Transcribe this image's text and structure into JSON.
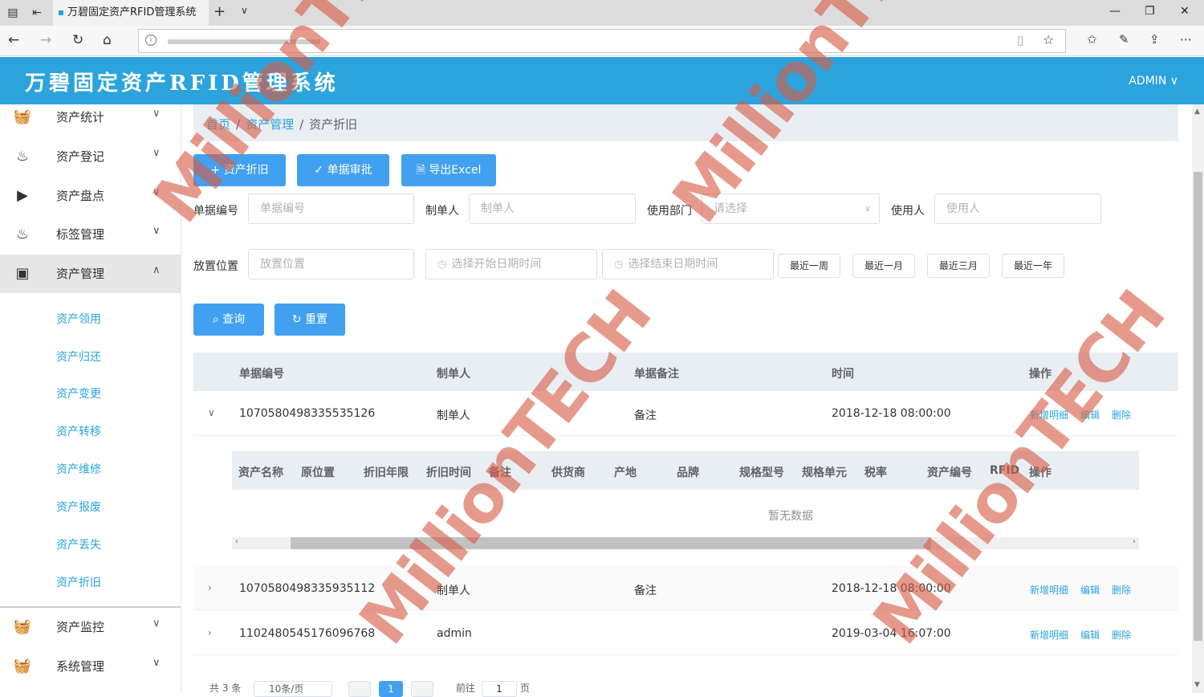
{
  "browser": {
    "tab_title": "万碧固定资产RFID管理系统"
  },
  "header": {
    "title": "万碧固定资产RFID管理系统",
    "user": "ADMIN"
  },
  "sidebar": {
    "items": [
      {
        "label": "资产统计",
        "icon": "basket-icon"
      },
      {
        "label": "资产登记",
        "icon": "flame-icon"
      },
      {
        "label": "资产盘点",
        "icon": "play-box-icon"
      },
      {
        "label": "标签管理",
        "icon": "flame-icon"
      },
      {
        "label": "资产管理",
        "icon": "gamepad-icon"
      },
      {
        "label": "资产监控",
        "icon": "basket-icon"
      },
      {
        "label": "系统管理",
        "icon": "basket-icon"
      }
    ],
    "submenu": [
      "资产领用",
      "资产归还",
      "资产变更",
      "资产转移",
      "资产维修",
      "资产报废",
      "资产丢失",
      "资产折旧"
    ]
  },
  "breadcrumb": {
    "home": "首页",
    "section": "资产管理",
    "current": "资产折旧"
  },
  "toolbar": {
    "add": "+ 资产折旧",
    "approve": "✓ 单据审批",
    "export": "导出Excel"
  },
  "filters": {
    "doc_no_label": "单据编号",
    "doc_no_placeholder": "单据编号",
    "maker_label": "制单人",
    "maker_placeholder": "制单人",
    "dept_label": "使用部门",
    "dept_placeholder": "请选择",
    "user_label": "使用人",
    "user_placeholder": "使用人",
    "location_label": "放置位置",
    "location_placeholder": "放置位置",
    "start_placeholder": "选择开始日期时间",
    "end_placeholder": "选择结束日期时间",
    "quick": [
      "最近一周",
      "最近一月",
      "最近三月",
      "最近一年"
    ],
    "search": "查询",
    "reset": "重置"
  },
  "table": {
    "columns": [
      "单据编号",
      "制单人",
      "单据备注",
      "时间",
      "操作"
    ],
    "rows": [
      {
        "id": "1070580498335535126",
        "maker": "制单人",
        "note": "备注",
        "time": "2018-12-18 08:00:00",
        "expanded": true
      },
      {
        "id": "1070580498335935112",
        "maker": "制单人",
        "note": "备注",
        "time": "2018-12-18 08:00:00",
        "expanded": false
      },
      {
        "id": "1102480545176096768",
        "maker": "admin",
        "note": "",
        "time": "2019-03-04 16:07:00",
        "expanded": false
      }
    ],
    "actions": [
      "新增明细",
      "编辑",
      "删除"
    ]
  },
  "subtable": {
    "columns": [
      "资产名称",
      "原位置",
      "折旧年限",
      "折旧时间",
      "备注",
      "供货商",
      "产地",
      "品牌",
      "规格型号",
      "规格单元",
      "税率",
      "资产编号",
      "RFID",
      "操作"
    ],
    "empty_text": "暂无数据"
  },
  "pagination": {
    "total": "共 3 条",
    "page_size": "10条/页",
    "current_page": "1",
    "goto_prefix": "前往",
    "goto_value": "1",
    "goto_suffix": "页"
  },
  "watermark": "MillionTECH",
  "colors": {
    "primary": "#2ba3dc",
    "button": "#41a0f0",
    "watermark": "#d75c46"
  }
}
